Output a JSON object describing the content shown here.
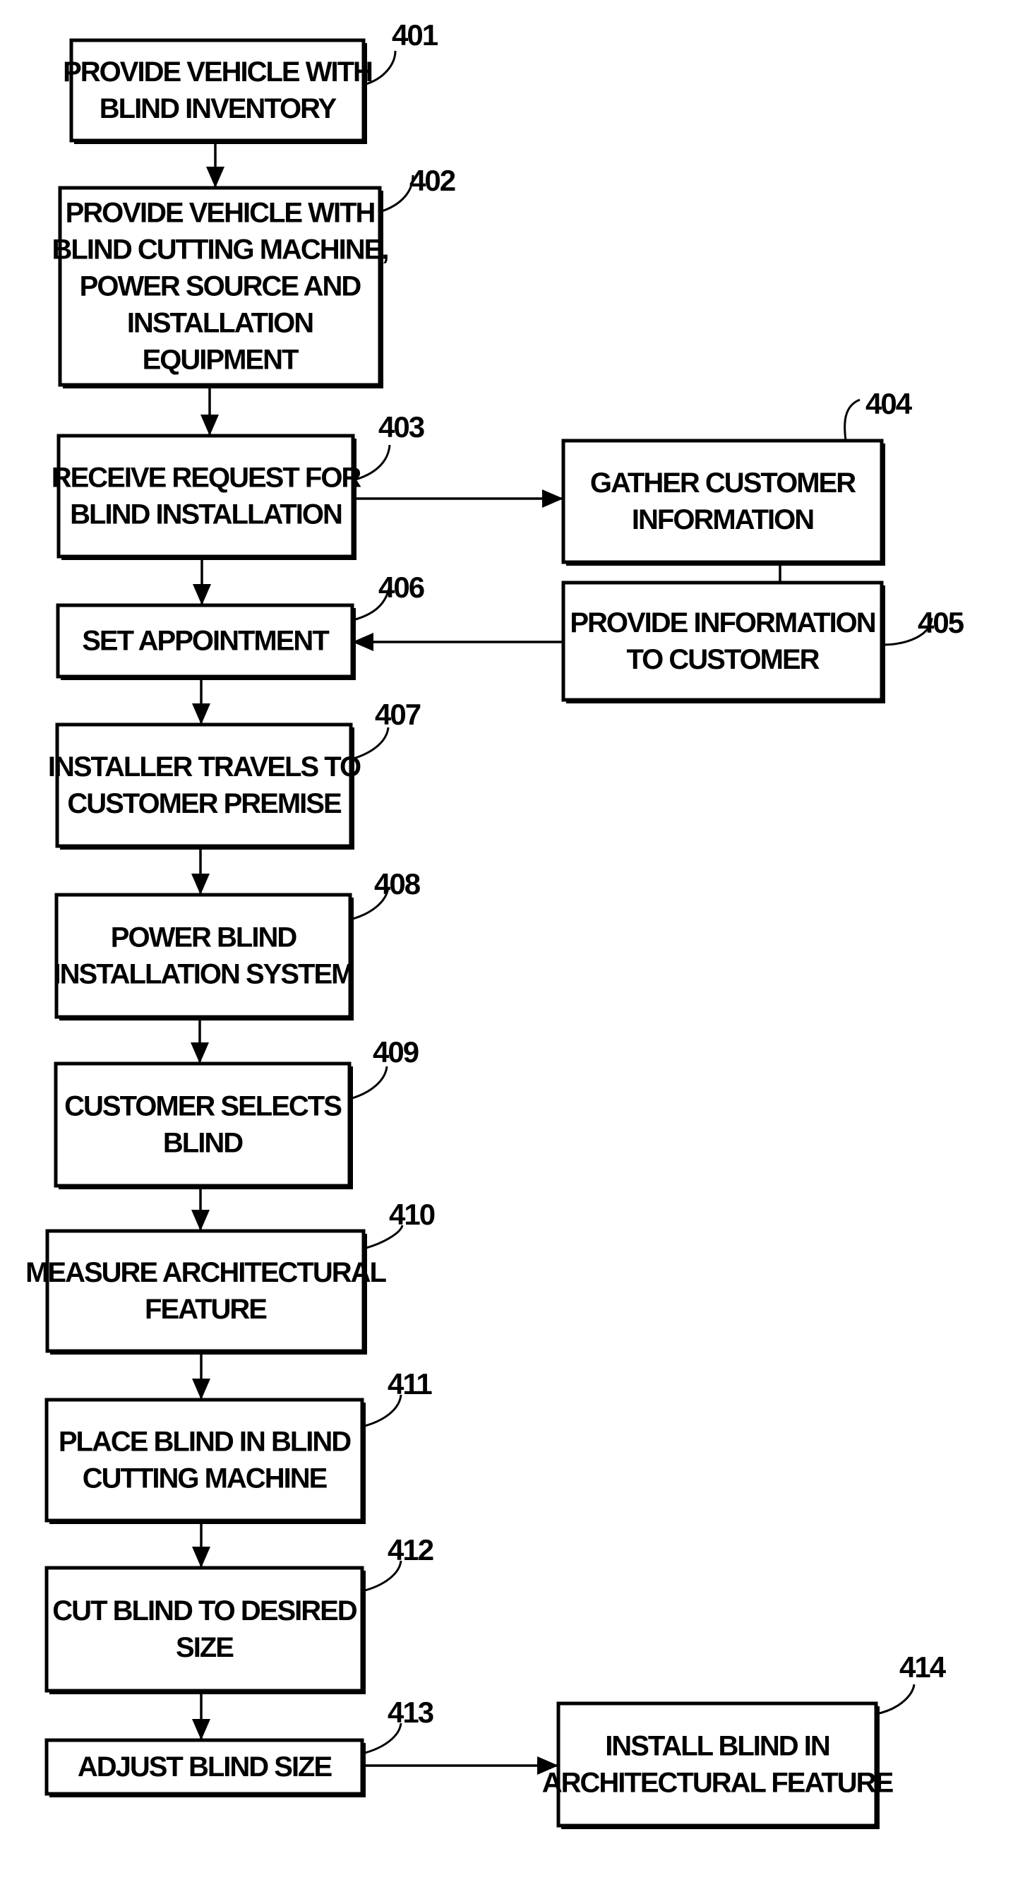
{
  "figure": {
    "type": "flowchart",
    "steps": [
      {
        "id": "401",
        "ref": "401",
        "lines": [
          "PROVIDE VEHICLE WITH",
          "BLIND INVENTORY"
        ]
      },
      {
        "id": "402",
        "ref": "402",
        "lines": [
          "PROVIDE VEHICLE WITH",
          "BLIND CUTTING MACHINE,",
          "POWER SOURCE AND",
          "INSTALLATION",
          "EQUIPMENT"
        ]
      },
      {
        "id": "403",
        "ref": "403",
        "lines": [
          "RECEIVE REQUEST FOR",
          "BLIND INSTALLATION"
        ]
      },
      {
        "id": "404",
        "ref": "404",
        "lines": [
          "GATHER CUSTOMER",
          "INFORMATION"
        ]
      },
      {
        "id": "405",
        "ref": "405",
        "lines": [
          "PROVIDE INFORMATION",
          "TO CUSTOMER"
        ]
      },
      {
        "id": "406",
        "ref": "406",
        "lines": [
          "SET APPOINTMENT"
        ]
      },
      {
        "id": "407",
        "ref": "407",
        "lines": [
          "INSTALLER TRAVELS TO",
          "CUSTOMER PREMISE"
        ]
      },
      {
        "id": "408",
        "ref": "408",
        "lines": [
          "POWER BLIND",
          "INSTALLATION SYSTEM"
        ]
      },
      {
        "id": "409",
        "ref": "409",
        "lines": [
          "CUSTOMER SELECTS",
          "BLIND"
        ]
      },
      {
        "id": "410",
        "ref": "410",
        "lines": [
          "MEASURE ARCHITECTURAL",
          "FEATURE"
        ]
      },
      {
        "id": "411",
        "ref": "411",
        "lines": [
          "PLACE BLIND IN BLIND",
          "CUTTING MACHINE"
        ]
      },
      {
        "id": "412",
        "ref": "412",
        "lines": [
          "CUT BLIND TO DESIRED",
          "SIZE"
        ]
      },
      {
        "id": "413",
        "ref": "413",
        "lines": [
          "ADJUST BLIND SIZE"
        ]
      },
      {
        "id": "414",
        "ref": "414",
        "lines": [
          "INSTALL BLIND IN",
          "ARCHITECTURAL FEATURE"
        ]
      }
    ],
    "connections": [
      {
        "from": "401",
        "to": "402",
        "arrow": true
      },
      {
        "from": "402",
        "to": "403",
        "arrow": true
      },
      {
        "from": "403",
        "to": "404",
        "arrow": true
      },
      {
        "from": "404",
        "to": "405",
        "arrow": false
      },
      {
        "from": "405",
        "to": "406",
        "arrow": true
      },
      {
        "from": "403",
        "to": "406",
        "arrow": true
      },
      {
        "from": "406",
        "to": "407",
        "arrow": true
      },
      {
        "from": "407",
        "to": "408",
        "arrow": true
      },
      {
        "from": "408",
        "to": "409",
        "arrow": true
      },
      {
        "from": "409",
        "to": "410",
        "arrow": true
      },
      {
        "from": "410",
        "to": "411",
        "arrow": true
      },
      {
        "from": "411",
        "to": "412",
        "arrow": true
      },
      {
        "from": "412",
        "to": "413",
        "arrow": true
      },
      {
        "from": "413",
        "to": "414",
        "arrow": true
      }
    ]
  }
}
